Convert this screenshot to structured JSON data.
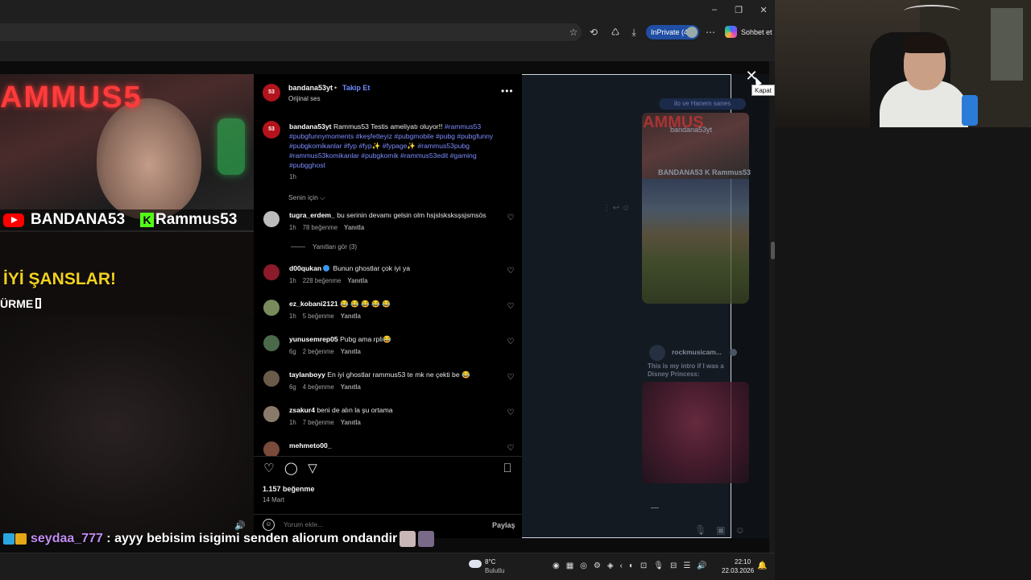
{
  "browser": {
    "window_controls": {
      "minimize": "–",
      "maximize": "❐",
      "close": "✕"
    },
    "inprivate_label": "InPrivate (4)",
    "copilot_label": "Sohbet et",
    "toolbar_icons": [
      "star-icon",
      "extensions-icon",
      "collections-icon",
      "download-icon",
      "more-icon"
    ]
  },
  "post": {
    "author": "bandana53yt",
    "dot": "•",
    "follow_label": "Takip Et",
    "audio_label": "Orijinal ses",
    "avatar_text": "53",
    "caption_author": "bandana53yt",
    "caption_text": "Rammus53 Testis ameliyatı oluyor!!",
    "caption_tags": "#rammus53 #pubgfunnymoments #keşfetteyiz #pubgmobile #pubg #pubgfunny #pubgkomikanlar #fyp #fyp✨ #fypage✨ #rammus53pubg #rammus53komikanlar #pubgkomik #rammus53edit #gaming #pubgghost",
    "caption_time": "1h",
    "sort_label": "Senin için ⌵",
    "likes": "1.157 beğenme",
    "date": "14 Mart",
    "comment_placeholder": "Yorum ekle...",
    "share_label": "Paylaş",
    "more_label": "•••"
  },
  "comments": [
    {
      "user": "tugra_erdem_",
      "text": "bu serinin devamı gelsin olm hsjslsksksşsjsmsös",
      "time": "1h",
      "likes": "78 beğenme",
      "reply": "Yanıtla",
      "avatar_color": "#bdbdbd",
      "verified": false
    },
    {
      "user": "d00qukan",
      "text": "Bunun ghostlar çok iyi ya",
      "time": "1h",
      "likes": "228 beğenme",
      "reply": "Yanıtla",
      "avatar_color": "#8b1a2a",
      "verified": true
    },
    {
      "user": "ez_kobani2121",
      "text": "😂 😂 😂 😂 😂",
      "time": "1h",
      "likes": "5 beğenme",
      "reply": "Yanıtla",
      "avatar_color": "#7a8a5a",
      "verified": false
    },
    {
      "user": "yunusemrep05",
      "text": "Pubg ama rpli😂",
      "time": "6g",
      "likes": "2 beğenme",
      "reply": "Yanıtla",
      "avatar_color": "#4a6a4a",
      "verified": false
    },
    {
      "user": "taylanboyy",
      "text": "En iyi ghostlar rammus53 te mk ne çekti be 😂",
      "time": "6g",
      "likes": "4 beğenme",
      "reply": "Yanıtla",
      "avatar_color": "#6a5a4a",
      "verified": false
    },
    {
      "user": "zsakur4",
      "text": "beni de alın la şu ortama",
      "time": "1h",
      "likes": "7 beğenme",
      "reply": "Yanıtla",
      "avatar_color": "#8a7a6a",
      "verified": false
    },
    {
      "user": "mehmeto00_",
      "text": "",
      "time": "",
      "likes": "",
      "reply": "",
      "avatar_color": "#7a4a3a",
      "verified": false
    }
  ],
  "replies_label": "Yanıtları gör (3)",
  "video": {
    "neon_text": "AMMUS5",
    "brand_left": "BANDANA53",
    "kick_letter": "K",
    "brand_right": "Rammus53",
    "luck_text": "İYİ ŞANSLAR!",
    "sub_text": "ÜRME"
  },
  "dm": {
    "chip_text": "ilo ve Hanem sanes",
    "card1_title": "bandana53yt",
    "card1_neon": "AMMUS",
    "card1_brand": "BANDANA53 K Rammus53",
    "user2": "rockmusicam...",
    "caption2": "This is my intro if I was a Disney Princess:"
  },
  "close_tooltip": "Kapat",
  "chat": {
    "user": "seydaa_777",
    "message": " : ayyy bebisim isigimi senden aliorum ondandir"
  },
  "taskbar": {
    "temp": "8°C",
    "weather": "Bulutlu",
    "time": "22:10",
    "date": "22.03.2026"
  }
}
